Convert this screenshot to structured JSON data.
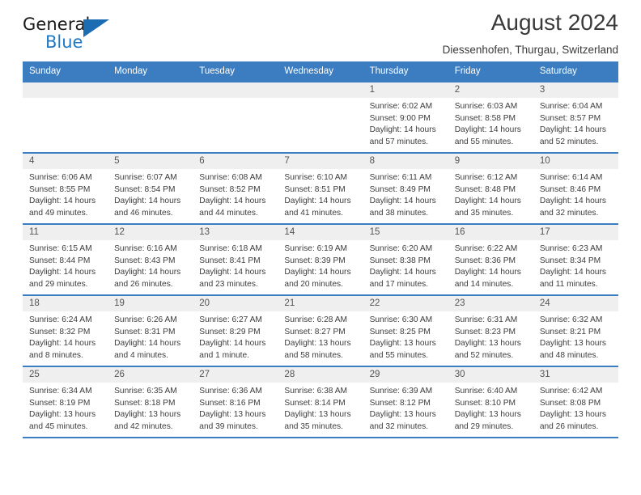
{
  "brand": {
    "name_top": "General",
    "name_bottom": "Blue",
    "accent_color": "#1c6cb4",
    "logo_icon": "blue-triangle-icon"
  },
  "header": {
    "title": "August 2024",
    "subtitle": "Diessenhofen, Thurgau, Switzerland"
  },
  "theme": {
    "header_blue": "#3b7dc0",
    "daynum_gray": "#efefef",
    "text": "#3c3c3c"
  },
  "weekday_headers": [
    "Sunday",
    "Monday",
    "Tuesday",
    "Wednesday",
    "Thursday",
    "Friday",
    "Saturday"
  ],
  "weeks": [
    [
      {
        "day": "",
        "sunrise": "",
        "sunset": "",
        "daylight": ""
      },
      {
        "day": "",
        "sunrise": "",
        "sunset": "",
        "daylight": ""
      },
      {
        "day": "",
        "sunrise": "",
        "sunset": "",
        "daylight": ""
      },
      {
        "day": "",
        "sunrise": "",
        "sunset": "",
        "daylight": ""
      },
      {
        "day": "1",
        "sunrise": "Sunrise: 6:02 AM",
        "sunset": "Sunset: 9:00 PM",
        "daylight": "Daylight: 14 hours and 57 minutes."
      },
      {
        "day": "2",
        "sunrise": "Sunrise: 6:03 AM",
        "sunset": "Sunset: 8:58 PM",
        "daylight": "Daylight: 14 hours and 55 minutes."
      },
      {
        "day": "3",
        "sunrise": "Sunrise: 6:04 AM",
        "sunset": "Sunset: 8:57 PM",
        "daylight": "Daylight: 14 hours and 52 minutes."
      }
    ],
    [
      {
        "day": "4",
        "sunrise": "Sunrise: 6:06 AM",
        "sunset": "Sunset: 8:55 PM",
        "daylight": "Daylight: 14 hours and 49 minutes."
      },
      {
        "day": "5",
        "sunrise": "Sunrise: 6:07 AM",
        "sunset": "Sunset: 8:54 PM",
        "daylight": "Daylight: 14 hours and 46 minutes."
      },
      {
        "day": "6",
        "sunrise": "Sunrise: 6:08 AM",
        "sunset": "Sunset: 8:52 PM",
        "daylight": "Daylight: 14 hours and 44 minutes."
      },
      {
        "day": "7",
        "sunrise": "Sunrise: 6:10 AM",
        "sunset": "Sunset: 8:51 PM",
        "daylight": "Daylight: 14 hours and 41 minutes."
      },
      {
        "day": "8",
        "sunrise": "Sunrise: 6:11 AM",
        "sunset": "Sunset: 8:49 PM",
        "daylight": "Daylight: 14 hours and 38 minutes."
      },
      {
        "day": "9",
        "sunrise": "Sunrise: 6:12 AM",
        "sunset": "Sunset: 8:48 PM",
        "daylight": "Daylight: 14 hours and 35 minutes."
      },
      {
        "day": "10",
        "sunrise": "Sunrise: 6:14 AM",
        "sunset": "Sunset: 8:46 PM",
        "daylight": "Daylight: 14 hours and 32 minutes."
      }
    ],
    [
      {
        "day": "11",
        "sunrise": "Sunrise: 6:15 AM",
        "sunset": "Sunset: 8:44 PM",
        "daylight": "Daylight: 14 hours and 29 minutes."
      },
      {
        "day": "12",
        "sunrise": "Sunrise: 6:16 AM",
        "sunset": "Sunset: 8:43 PM",
        "daylight": "Daylight: 14 hours and 26 minutes."
      },
      {
        "day": "13",
        "sunrise": "Sunrise: 6:18 AM",
        "sunset": "Sunset: 8:41 PM",
        "daylight": "Daylight: 14 hours and 23 minutes."
      },
      {
        "day": "14",
        "sunrise": "Sunrise: 6:19 AM",
        "sunset": "Sunset: 8:39 PM",
        "daylight": "Daylight: 14 hours and 20 minutes."
      },
      {
        "day": "15",
        "sunrise": "Sunrise: 6:20 AM",
        "sunset": "Sunset: 8:38 PM",
        "daylight": "Daylight: 14 hours and 17 minutes."
      },
      {
        "day": "16",
        "sunrise": "Sunrise: 6:22 AM",
        "sunset": "Sunset: 8:36 PM",
        "daylight": "Daylight: 14 hours and 14 minutes."
      },
      {
        "day": "17",
        "sunrise": "Sunrise: 6:23 AM",
        "sunset": "Sunset: 8:34 PM",
        "daylight": "Daylight: 14 hours and 11 minutes."
      }
    ],
    [
      {
        "day": "18",
        "sunrise": "Sunrise: 6:24 AM",
        "sunset": "Sunset: 8:32 PM",
        "daylight": "Daylight: 14 hours and 8 minutes."
      },
      {
        "day": "19",
        "sunrise": "Sunrise: 6:26 AM",
        "sunset": "Sunset: 8:31 PM",
        "daylight": "Daylight: 14 hours and 4 minutes."
      },
      {
        "day": "20",
        "sunrise": "Sunrise: 6:27 AM",
        "sunset": "Sunset: 8:29 PM",
        "daylight": "Daylight: 14 hours and 1 minute."
      },
      {
        "day": "21",
        "sunrise": "Sunrise: 6:28 AM",
        "sunset": "Sunset: 8:27 PM",
        "daylight": "Daylight: 13 hours and 58 minutes."
      },
      {
        "day": "22",
        "sunrise": "Sunrise: 6:30 AM",
        "sunset": "Sunset: 8:25 PM",
        "daylight": "Daylight: 13 hours and 55 minutes."
      },
      {
        "day": "23",
        "sunrise": "Sunrise: 6:31 AM",
        "sunset": "Sunset: 8:23 PM",
        "daylight": "Daylight: 13 hours and 52 minutes."
      },
      {
        "day": "24",
        "sunrise": "Sunrise: 6:32 AM",
        "sunset": "Sunset: 8:21 PM",
        "daylight": "Daylight: 13 hours and 48 minutes."
      }
    ],
    [
      {
        "day": "25",
        "sunrise": "Sunrise: 6:34 AM",
        "sunset": "Sunset: 8:19 PM",
        "daylight": "Daylight: 13 hours and 45 minutes."
      },
      {
        "day": "26",
        "sunrise": "Sunrise: 6:35 AM",
        "sunset": "Sunset: 8:18 PM",
        "daylight": "Daylight: 13 hours and 42 minutes."
      },
      {
        "day": "27",
        "sunrise": "Sunrise: 6:36 AM",
        "sunset": "Sunset: 8:16 PM",
        "daylight": "Daylight: 13 hours and 39 minutes."
      },
      {
        "day": "28",
        "sunrise": "Sunrise: 6:38 AM",
        "sunset": "Sunset: 8:14 PM",
        "daylight": "Daylight: 13 hours and 35 minutes."
      },
      {
        "day": "29",
        "sunrise": "Sunrise: 6:39 AM",
        "sunset": "Sunset: 8:12 PM",
        "daylight": "Daylight: 13 hours and 32 minutes."
      },
      {
        "day": "30",
        "sunrise": "Sunrise: 6:40 AM",
        "sunset": "Sunset: 8:10 PM",
        "daylight": "Daylight: 13 hours and 29 minutes."
      },
      {
        "day": "31",
        "sunrise": "Sunrise: 6:42 AM",
        "sunset": "Sunset: 8:08 PM",
        "daylight": "Daylight: 13 hours and 26 minutes."
      }
    ]
  ]
}
